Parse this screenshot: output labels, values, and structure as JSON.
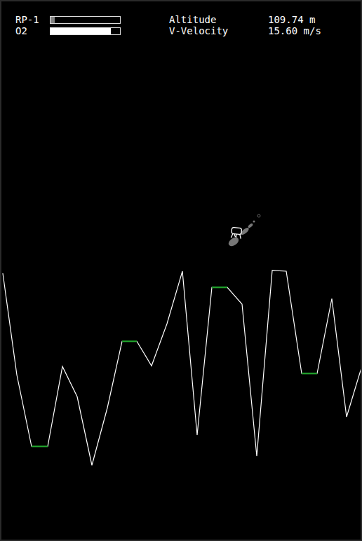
{
  "hud": {
    "gauges": [
      {
        "label": "RP-1",
        "level": 0.06,
        "color": "#808080"
      },
      {
        "label": "O2",
        "level": 0.87,
        "color": "#ffffff"
      }
    ],
    "readouts": [
      {
        "label": "Altitude",
        "value": "109.74 m"
      },
      {
        "label": "V-Velocity",
        "value": "15.60 m/s"
      }
    ]
  },
  "lander": {
    "thrusting": true
  }
}
